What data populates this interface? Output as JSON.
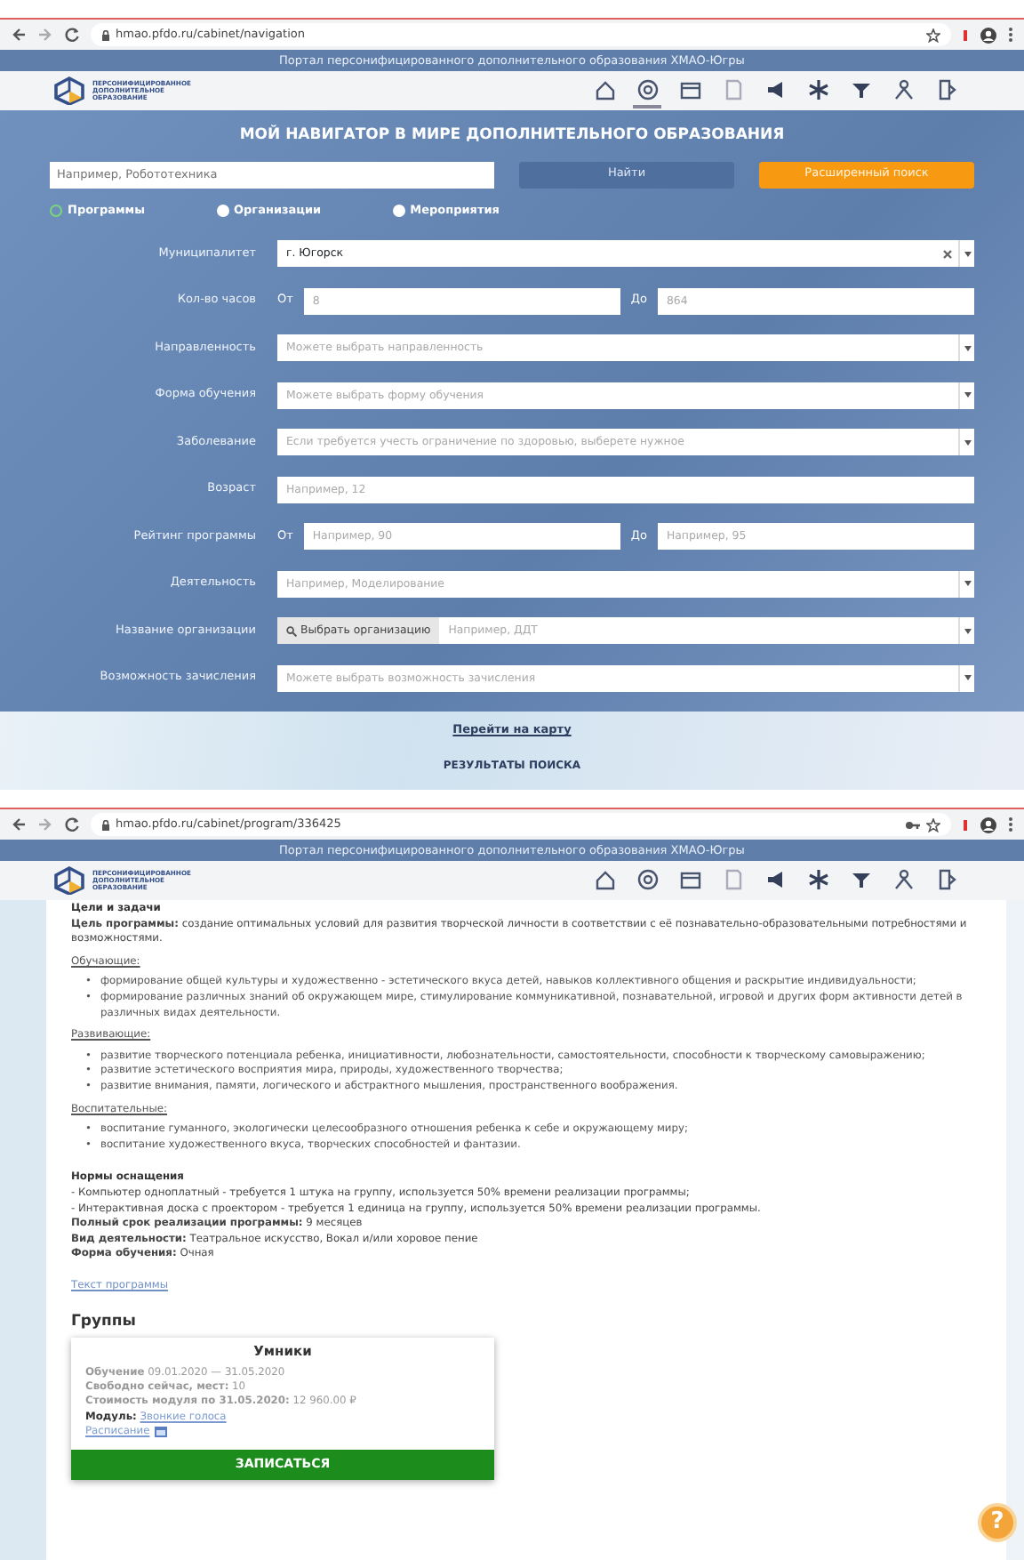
{
  "search_screen": {
    "browser": {
      "url": "hmao.pfdo.ru/cabinet/navigation",
      "key_icon": false
    },
    "banner": "Портал персонифицированного дополнительного образования ХМАО-Югры",
    "logo_text": [
      "ПЕРСОНИФИЦИРОВАННОЕ",
      "ДОПОЛНИТЕЛЬНОЕ",
      "ОБРАЗОВАНИЕ"
    ],
    "nav_items": [
      {
        "selected": false
      },
      {
        "selected": true
      },
      {
        "selected": false
      },
      {
        "selected": false
      },
      {
        "selected": false
      },
      {
        "selected": false
      },
      {
        "selected": false
      },
      {
        "selected": false
      },
      {
        "selected": false
      }
    ],
    "title": "МОЙ НАВИГАТОР В МИРЕ ДОПОЛНИТЕЛЬНОГО ОБРАЗОВАНИЯ",
    "search": {
      "placeholder": "Например, Робототехника"
    },
    "find_button": "Найти",
    "advanced_button": "Расширенный поиск",
    "search_types": [
      {
        "label": "Программы",
        "selected": true
      },
      {
        "label": "Организации",
        "selected": false
      },
      {
        "label": "Мероприятия",
        "selected": false
      }
    ],
    "filters": [
      {
        "kind": "select",
        "label": "Муниципалитет",
        "value": "г. Югорск",
        "clearable": true
      },
      {
        "kind": "range",
        "label": "Кол-во часов",
        "from_label": "От",
        "from_placeholder": "8",
        "to_label": "До",
        "to_placeholder": "864"
      },
      {
        "kind": "select",
        "label": "Направленность",
        "placeholder": "Можете выбрать направленность"
      },
      {
        "kind": "select",
        "label": "Форма обучения",
        "placeholder": "Можете выбрать форму обучения"
      },
      {
        "kind": "select",
        "label": "Заболевание",
        "placeholder": "Если требуется учесть ограничение по здоровью, выберете нужное"
      },
      {
        "kind": "input",
        "label": "Возраст",
        "placeholder": "Например, 12"
      },
      {
        "kind": "range",
        "label": "Рейтинг программы",
        "from_label": "От",
        "from_placeholder": "Например, 90",
        "to_label": "До",
        "to_placeholder": "Например, 95"
      },
      {
        "kind": "select",
        "label": "Деятельность",
        "placeholder": "Например, Моделирование"
      },
      {
        "kind": "org",
        "label": "Название организации",
        "button": "Выбрать организацию",
        "placeholder": "Например, ДДТ"
      },
      {
        "kind": "select",
        "label": "Возможность зачисления",
        "placeholder": "Можете выбрать возможность зачисления"
      }
    ],
    "map_link": "Перейти на карту",
    "results_heading": "РЕЗУЛЬТАТЫ ПОИСКА"
  },
  "program_screen": {
    "browser": {
      "url": "hmao.pfdo.ru/cabinet/program/336425",
      "key_icon": true
    },
    "banner": "Портал персонифицированного дополнительного образования ХМАО-Югры",
    "logo_text": [
      "ПЕРСОНИФИЦИРОВАННОЕ",
      "ДОПОЛНИТЕЛЬНОЕ",
      "ОБРАЗОВАНИЕ"
    ],
    "nav_items": [
      {
        "selected": false
      },
      {
        "selected": false
      },
      {
        "selected": false
      },
      {
        "selected": false
      },
      {
        "selected": false
      },
      {
        "selected": false
      },
      {
        "selected": false
      },
      {
        "selected": false
      },
      {
        "selected": false
      }
    ],
    "goals_heading": "Цели и задачи",
    "goal": "**Цель программы:** создание оптимальных условий для развития творческой личности в соответствии с её познавательно-образовательными потребностями и возможностями.",
    "task_groups": [
      {
        "title": "Обучающие:",
        "marker": "•",
        "items": [
          "формирование общей культуры и художественно - эстетического вкуса детей, навыков коллективного общения и раскрытие индивидуальности;",
          "формирование различных знаний об окружающем мире, стимулирование коммуникативной, познавательной, игровой и других форм активности детей в различных видах деятельности."
        ]
      },
      {
        "title": "Развивающие:",
        "marker": "•",
        "items": [
          "развитие творческого потенциала ребенка, инициативности, любознательности, самостоятельности, способности к творческому самовыражению;",
          "развитие эстетического восприятия мира, природы, художественного творчества;",
          "развитие внимания, памяти, логического и абстрактного мышления, пространственного воображения."
        ]
      },
      {
        "title": "Воспитательные:",
        "marker": "•",
        "items": [
          "воспитание гуманного, экологически целесообразного отношения ребенка к себе и окружающему миру;",
          "воспитание художественного вкуса, творческих способностей и фантазии."
        ]
      }
    ],
    "equipment_heading": "Нормы оснащения",
    "equipment": [
      "- Компьютер одноплатный - требуется 1 штука на группу, используется 50% времени реализации программы;",
      "- Интерактивная доска с проектором - требуется 1 единица на группу, используется 50% времени реализации программы."
    ],
    "facts": [
      "**Полный срок реализации программы:** 9 месяцев",
      "**Вид деятельности:** Театральное искусство, Вокал и/или хоровое пение",
      "**Форма обучения:** Очная"
    ],
    "program_text_link": "Текст программы",
    "groups_heading": "Группы",
    "group_card": {
      "name": "Умники",
      "lines": [
        "**Обучение** 09.01.2020 — 31.05.2020",
        "**Свободно сейчас, мест:** 10",
        "**Стоимость модуля по 31.05.2020:** 12 960.00 ₽"
      ],
      "module_label": "Модуль:",
      "module_value": "Звонкие голоса",
      "schedule_link": "Расписание",
      "enroll_button": "ЗАПИСАТЬСЯ"
    },
    "help_button": "?"
  }
}
